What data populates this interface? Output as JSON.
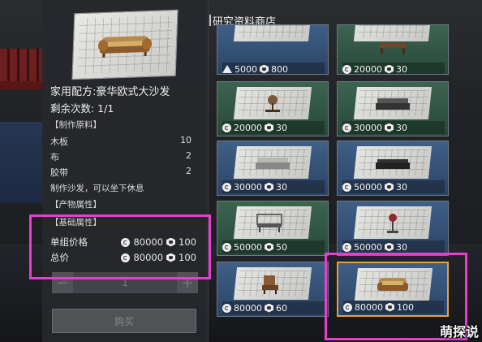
{
  "detail": {
    "title": "家用配方:豪华欧式大沙发",
    "remaining": "剩余次数: 1/1",
    "materials_header": "【制作原料】",
    "materials": [
      {
        "name": "木板",
        "qty": "10"
      },
      {
        "name": "布",
        "qty": "2"
      },
      {
        "name": "胶带",
        "qty": "2"
      }
    ],
    "description": "制作沙发，可以坐下休息",
    "product_header": "【产物属性】",
    "basic_header": "【基础属性】",
    "unit_price_label": "单组价格",
    "unit_price_gold": "80000",
    "unit_price_hex": "100",
    "total_label": "总价",
    "total_gold": "80000",
    "total_hex": "100",
    "quantity": "1",
    "minus": "−",
    "plus": "+",
    "buy_label": "购买"
  },
  "shop": {
    "title": "研究资料商店",
    "items": [
      {
        "gold": "5000",
        "hex": "800",
        "theme": "blue",
        "currency": "tri"
      },
      {
        "gold": "20000",
        "hex": "30",
        "theme": "green",
        "currency": "coin"
      },
      {
        "gold": "20000",
        "hex": "30",
        "theme": "green",
        "currency": "coin"
      },
      {
        "gold": "30000",
        "hex": "30",
        "theme": "green",
        "currency": "coin"
      },
      {
        "gold": "30000",
        "hex": "30",
        "theme": "blue",
        "currency": "coin"
      },
      {
        "gold": "50000",
        "hex": "30",
        "theme": "blue",
        "currency": "coin"
      },
      {
        "gold": "50000",
        "hex": "50",
        "theme": "green",
        "currency": "coin"
      },
      {
        "gold": "50000",
        "hex": "30",
        "theme": "blue",
        "currency": "coin"
      },
      {
        "gold": "80000",
        "hex": "60",
        "theme": "blue",
        "currency": "coin"
      },
      {
        "gold": "80000",
        "hex": "100",
        "theme": "blue",
        "currency": "coin",
        "selected": true
      }
    ]
  },
  "colors": {
    "highlight": "#e53fd0",
    "selected_border": "#e3a046"
  },
  "watermark": "萌探说"
}
